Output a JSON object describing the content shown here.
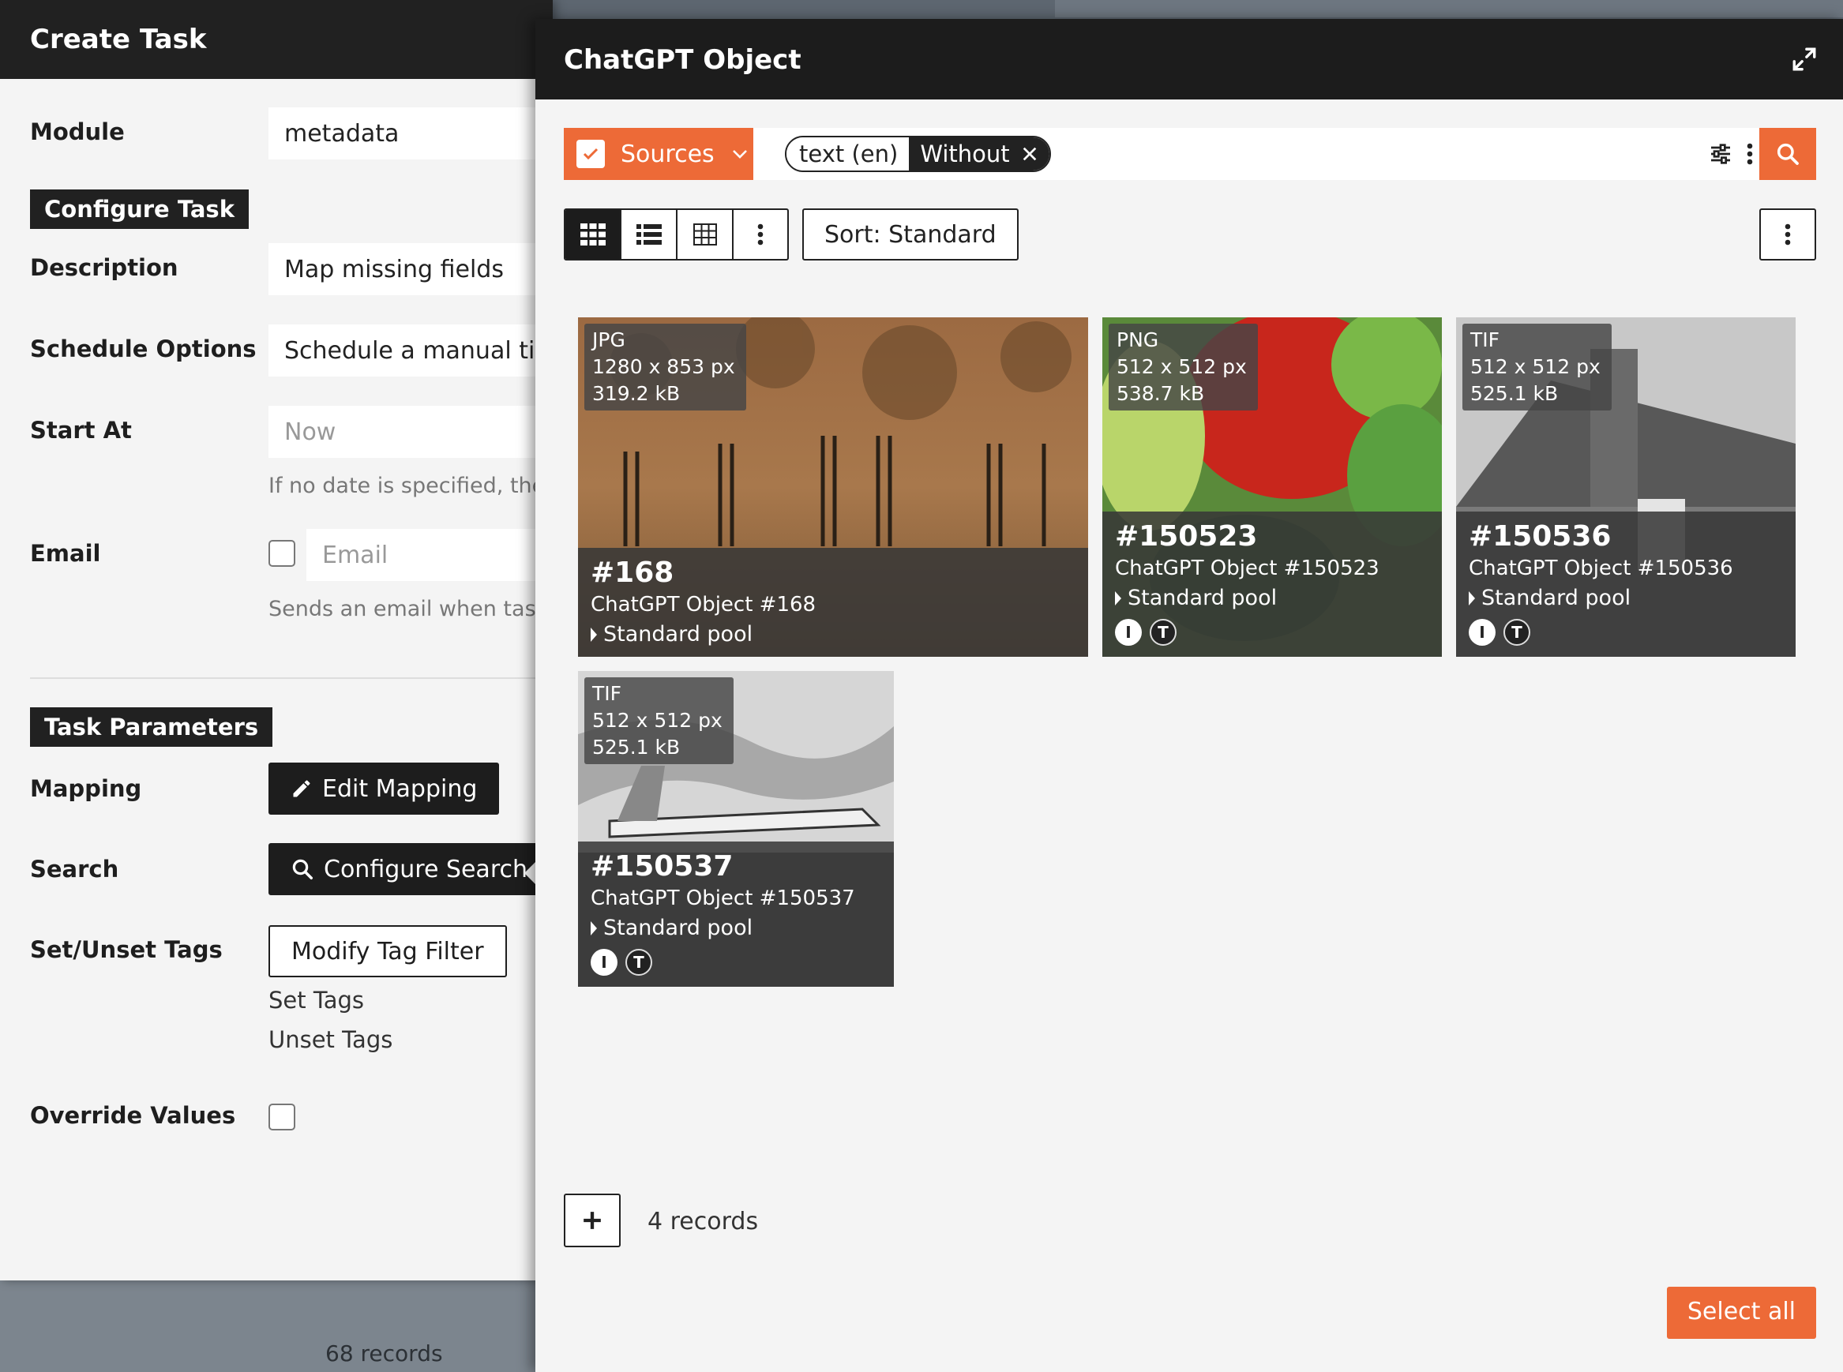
{
  "background": {
    "records_label": "68 records"
  },
  "task_dialog": {
    "title": "Create Task",
    "module": {
      "label": "Module",
      "value": "metadata"
    },
    "configure_section": "Configure Task",
    "description": {
      "label": "Description",
      "value": "Map missing fields"
    },
    "schedule": {
      "label": "Schedule Options",
      "value": "Schedule a manual time"
    },
    "start_at": {
      "label": "Start At",
      "placeholder": "Now",
      "hint": "If no date is specified, the ta"
    },
    "email": {
      "label": "Email",
      "placeholder": "Email",
      "hint": "Sends an email when task is"
    },
    "parameters_section": "Task Parameters",
    "mapping": {
      "label": "Mapping",
      "button": "Edit Mapping"
    },
    "search": {
      "label": "Search",
      "button": "Configure Search"
    },
    "tags": {
      "label": "Set/Unset Tags",
      "button": "Modify Tag Filter",
      "set": "Set Tags",
      "unset": "Unset Tags"
    },
    "override": {
      "label": "Override Values"
    }
  },
  "object_dialog": {
    "title": "ChatGPT Object",
    "sources_label": "Sources",
    "filter_chip": {
      "field": "text (en)",
      "mode": "Without"
    },
    "sort_label": "Sort: Standard",
    "records_label": "4 records",
    "select_all_label": "Select all",
    "cards": [
      {
        "format": "JPG",
        "dims": "1280 x 853 px",
        "size": "319.2 kB",
        "id": "#168",
        "title": "ChatGPT Object #168",
        "pool": "Standard pool",
        "badge_i": "",
        "badge_t": ""
      },
      {
        "format": "PNG",
        "dims": "512 x 512 px",
        "size": "538.7 kB",
        "id": "#150523",
        "title": "ChatGPT Object #150523",
        "pool": "Standard pool",
        "badge_i": "I",
        "badge_t": "T"
      },
      {
        "format": "TIF",
        "dims": "512 x 512 px",
        "size": "525.1 kB",
        "id": "#150536",
        "title": "ChatGPT Object #150536",
        "pool": "Standard pool",
        "badge_i": "I",
        "badge_t": "T"
      },
      {
        "format": "TIF",
        "dims": "512 x 512 px",
        "size": "525.1 kB",
        "id": "#150537",
        "title": "ChatGPT Object #150537",
        "pool": "Standard pool",
        "badge_i": "I",
        "badge_t": "T"
      }
    ]
  },
  "colors": {
    "accent": "#ed6a37",
    "header_dark": "#1c1c1c",
    "panel_bg": "#f4f4f4"
  }
}
